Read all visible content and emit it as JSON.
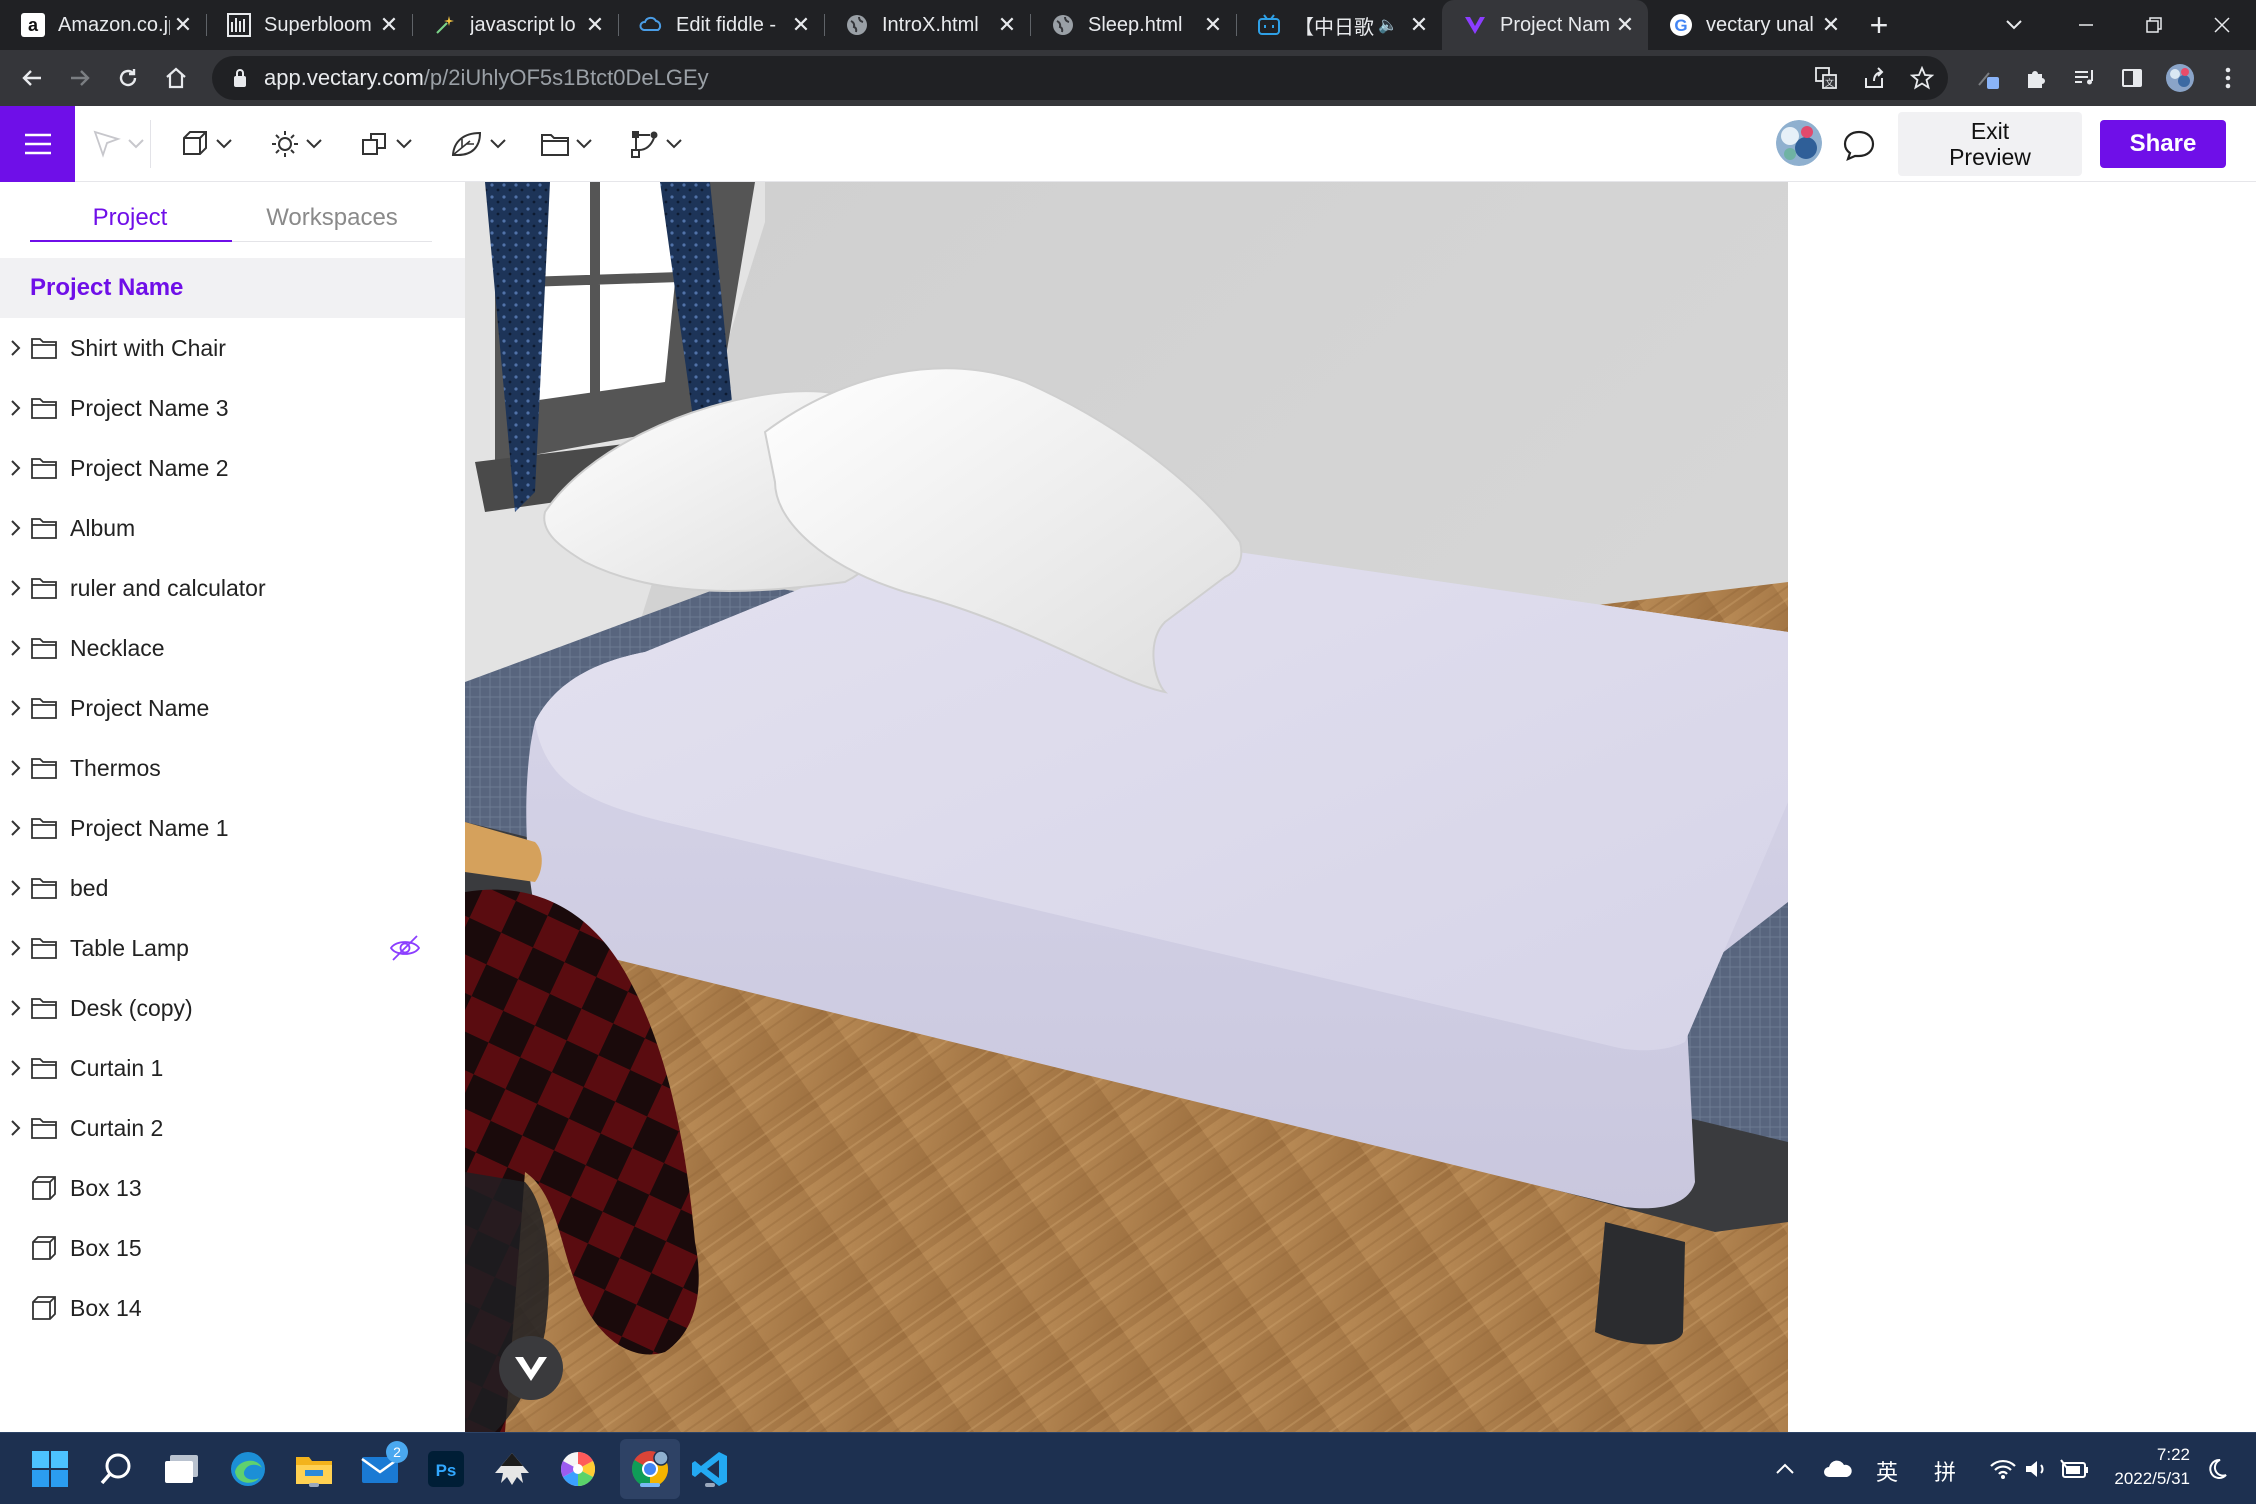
{
  "browser": {
    "tabs": [
      {
        "title": "Amazon.co.jp",
        "favicon": "amazon-icon",
        "active": false
      },
      {
        "title": "Superbloom",
        "favicon": "superbloom-icon",
        "active": false
      },
      {
        "title": "javascript lo",
        "favicon": "sparkle-icon",
        "active": false
      },
      {
        "title": "Edit fiddle -",
        "favicon": "jsfiddle-icon",
        "active": false
      },
      {
        "title": "IntroX.html",
        "favicon": "globe-icon",
        "active": false
      },
      {
        "title": "Sleep.html",
        "favicon": "globe-icon",
        "active": false
      },
      {
        "title": "【中日歌",
        "favicon": "bilibili-icon",
        "active": false
      },
      {
        "title": "Project Nam",
        "favicon": "vectary-icon",
        "active": true
      },
      {
        "title": "vectary unal",
        "favicon": "google-icon",
        "active": false
      }
    ],
    "new_tab_label": "+",
    "url_host": "app.vectary.com",
    "url_path": "/p/2iUhlyOF5s1Btct0DeLGEy"
  },
  "app": {
    "exit_preview_label": "Exit\nPreview",
    "share_label": "Share",
    "accent_color": "#6f0fe8"
  },
  "sidebar": {
    "tabs": [
      "Project",
      "Workspaces"
    ],
    "active_tab": "Project",
    "project_name": "Project Name",
    "items": [
      {
        "label": "Shirt with Chair",
        "type": "folder"
      },
      {
        "label": "Project Name 3",
        "type": "folder"
      },
      {
        "label": "Project Name 2",
        "type": "folder"
      },
      {
        "label": "Album",
        "type": "folder"
      },
      {
        "label": "ruler and calculator",
        "type": "folder"
      },
      {
        "label": "Necklace",
        "type": "folder"
      },
      {
        "label": "Project Name",
        "type": "folder"
      },
      {
        "label": "Thermos",
        "type": "folder"
      },
      {
        "label": "Project Name 1",
        "type": "folder"
      },
      {
        "label": "bed",
        "type": "folder"
      },
      {
        "label": "Table Lamp",
        "type": "folder",
        "hidden": true
      },
      {
        "label": "Desk (copy)",
        "type": "folder"
      },
      {
        "label": "Curtain 1",
        "type": "folder"
      },
      {
        "label": "Curtain 2",
        "type": "folder"
      },
      {
        "label": "Box 13",
        "type": "box"
      },
      {
        "label": "Box 15",
        "type": "box"
      },
      {
        "label": "Box 14",
        "type": "box"
      }
    ]
  },
  "taskbar": {
    "mail_badge": "2",
    "ime_lang": "英",
    "ime_mode": "拼",
    "time": "7:22",
    "date": "2022/5/31"
  }
}
